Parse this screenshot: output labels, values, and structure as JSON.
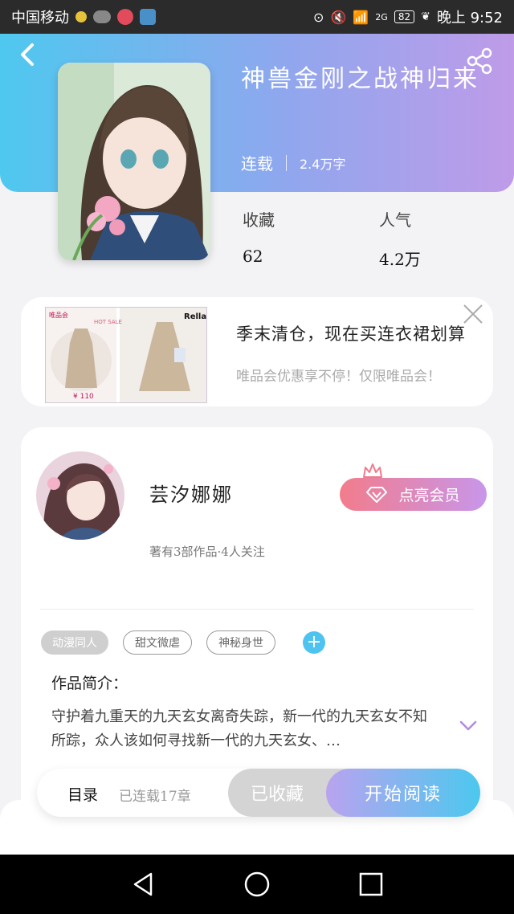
{
  "status_bar": {
    "carrier": "中国移动",
    "battery": "82",
    "network": "2G",
    "time": "晚上 9:52"
  },
  "book": {
    "title": "神兽金刚之战神归来",
    "status": "连载",
    "word_count": "2.4万字",
    "stats": [
      {
        "label": "收藏",
        "value": "62"
      },
      {
        "label": "人气",
        "value": "4.2万"
      }
    ]
  },
  "ad": {
    "title": "季末清仓，现在买连衣裙划算",
    "subtitle": "唯品会优惠享不停！仅限唯品会！",
    "image_label_brand": "Rella",
    "image_price": "¥ 110",
    "image_badge": "HOT SALE"
  },
  "author": {
    "name": "芸汐娜娜",
    "info": "著有3部作品·4人关注",
    "vip_label": "点亮会员"
  },
  "tags": [
    "动漫同人",
    "甜文微虐",
    "神秘身世"
  ],
  "intro": {
    "heading": "作品简介：",
    "text": "守护着九重天的九天玄女离奇失踪，新一代的九天玄女不知所踪，众人该如何寻找新一代的九天玄女、…"
  },
  "action_bar": {
    "toc_label": "目录",
    "serial_label": "已连载17章",
    "favorited_label": "已收藏",
    "read_label": "开始阅读"
  },
  "colors": {
    "header_start": "#4ec8ef",
    "header_end": "#bf9be8",
    "vip_start": "#f27c8c",
    "vip_end": "#c896ea",
    "accent_blue": "#4fc3f0"
  }
}
